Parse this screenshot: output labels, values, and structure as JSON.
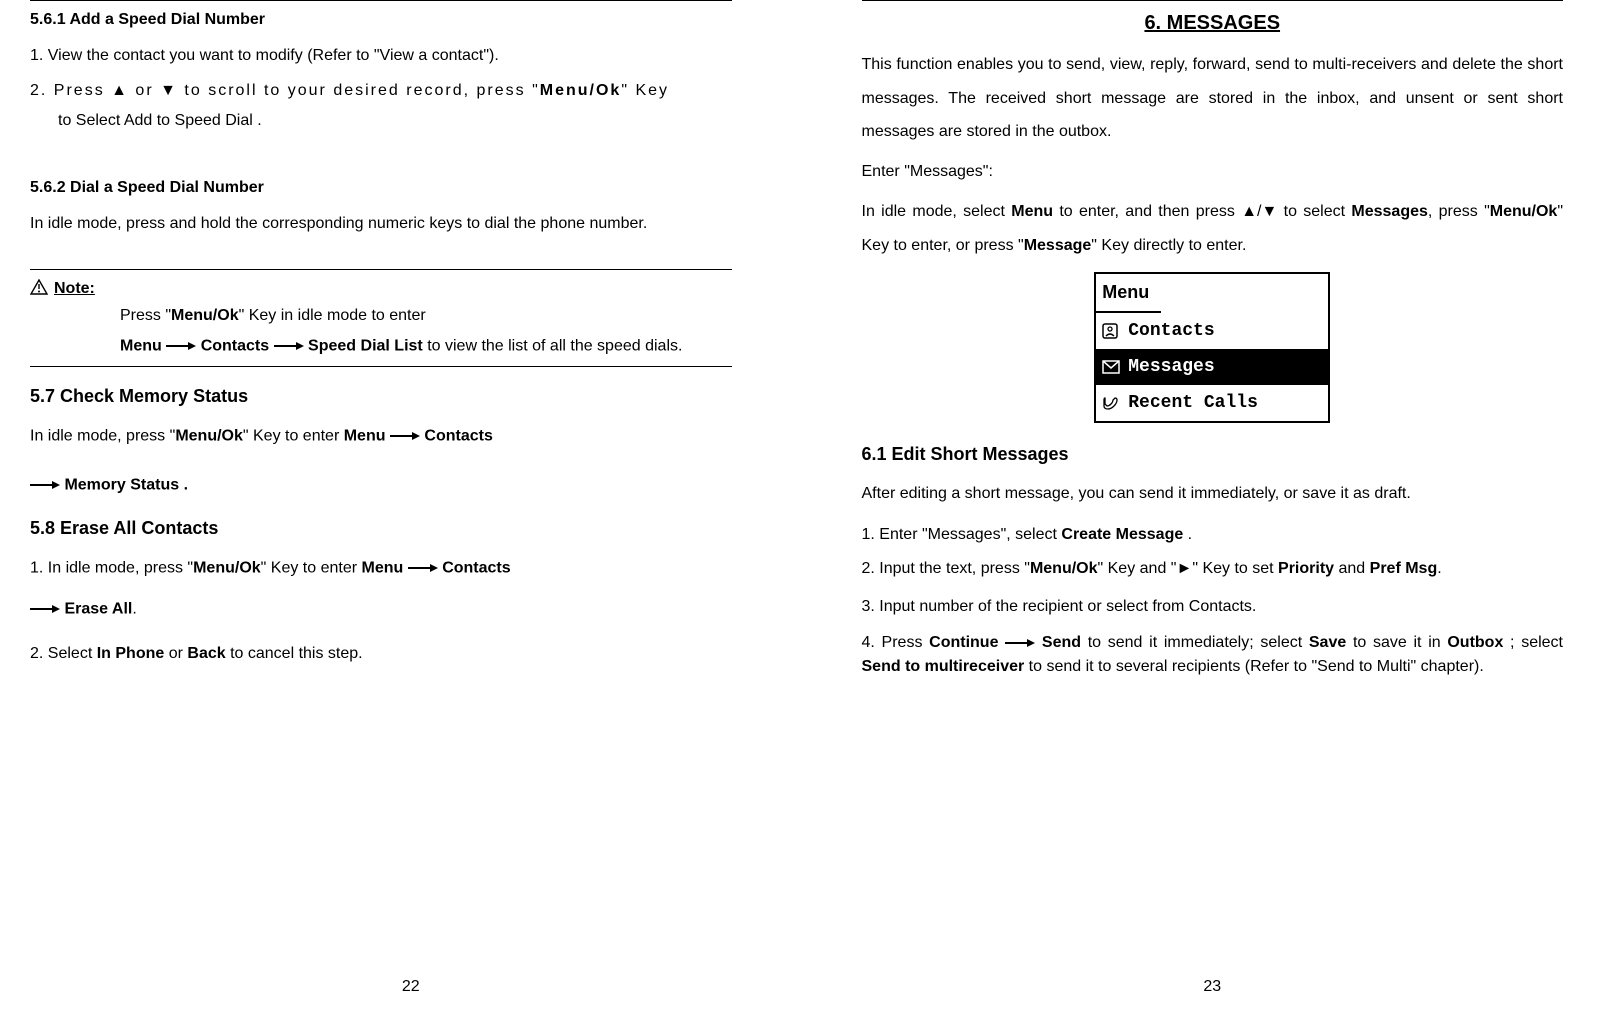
{
  "left": {
    "s561_title": "5.6.1 Add a Speed Dial Number",
    "s561_step1": "1.  View the contact you want to modify (Refer to \"View a contact\").",
    "s561_step2_a": "2. Press ",
    "s561_step2_up": "▲",
    "s561_step2_or": " or ",
    "s561_step2_dn": "▼",
    "s561_step2_b": " to scroll to your desired record, press \"",
    "s561_step2_menu": "Menu/Ok",
    "s561_step2_c": "\" Key",
    "s561_step2_d": "to Select Add to Speed Dial .",
    "s562_title": "5.6.2 Dial a Speed Dial Number",
    "s562_body": "In idle mode, press and hold the corresponding numeric keys to dial the phone number.",
    "note_label": "Note:",
    "note_l1_a": "Press \"",
    "note_l1_menu": "Menu/Ok",
    "note_l1_b": "\" Key in idle mode to enter",
    "note_l2_menu": "Menu",
    "note_l2_contacts": "Contacts",
    "note_l2_speed": "Speed Dial List",
    "note_l2_tail": " to view the list of all the speed dials.",
    "s57_title": "5.7 Check Memory Status",
    "s57_a": "In idle mode, press \"",
    "s57_menu": "Menu/Ok",
    "s57_b": "\" Key to enter ",
    "s57_menu2": "Menu",
    "s57_contacts": "Contacts",
    "s57_mem": "Memory Status .",
    "s58_title": "5.8 Erase All Contacts",
    "s58_1a": "1. In idle mode, press \"",
    "s58_1menu": "Menu/Ok",
    "s58_1b": "\" Key to enter ",
    "s58_1menu2": "Menu",
    "s58_1contacts": "Contacts",
    "s58_erase": "Erase All",
    "s58_2a": "2. Select ",
    "s58_2inphone": "In Phone",
    "s58_2or": " or ",
    "s58_2back": "Back",
    "s58_2tail": " to cancel this step.",
    "pagenum": "22"
  },
  "right": {
    "chap_title": "6. MESSAGES",
    "intro": "This function enables you to send, view, reply, forward, send to multi-receivers and delete the short messages. The received short message are stored in the inbox, and unsent or sent short messages are stored in the outbox.",
    "enter": "Enter \"Messages\":",
    "idle_a": "In idle mode, select ",
    "idle_menu": "Menu",
    "idle_b": " to enter, and then press ",
    "idle_up": "▲",
    "idle_slash": "/",
    "idle_dn": "▼",
    "idle_c": " to select ",
    "idle_msgs": "Messages",
    "idle_d": ", press \"",
    "idle_menuok": "Menu/Ok",
    "idle_e": "\" Key  to enter, or press \"",
    "idle_message": "Message",
    "idle_f": "\" Key directly  to enter.",
    "screen": {
      "title": "Menu",
      "row1": "Contacts",
      "row2": "Messages",
      "row3": "Recent Calls"
    },
    "s61_title": "6.1 Edit Short Messages",
    "s61_intro": "After editing a short message, you can send it immediately, or save it as draft.",
    "s61_1a": "1. Enter \"Messages\", select ",
    "s61_1create": "Create Message",
    "s61_1tail": " .",
    "s61_2a": "2. Input the text, press \"",
    "s61_2menu": "Menu/Ok",
    "s61_2b": "\" Key  and \"",
    "s61_2arrow": "►",
    "s61_2c": "\" Key to set ",
    "s61_2priority": "Priority",
    "s61_2and": " and ",
    "s61_2pref": "Pref Msg",
    "s61_2d": ".",
    "s61_3": "3. Input number of the recipient or select from Contacts.",
    "s61_4a": "4. Press ",
    "s61_4cont": "Continue",
    "s61_4send": "Send",
    "s61_4b": " to send it immediately; select ",
    "s61_4save": "Save",
    "s61_4c": " to save it in ",
    "s61_4outbox": "Outbox",
    "s61_4d": " ; select ",
    "s61_4multi": "Send to multireceiver",
    "s61_4e": " to send it to several recipients (Refer to \"Send to Multi\" chapter).",
    "pagenum": "23"
  }
}
